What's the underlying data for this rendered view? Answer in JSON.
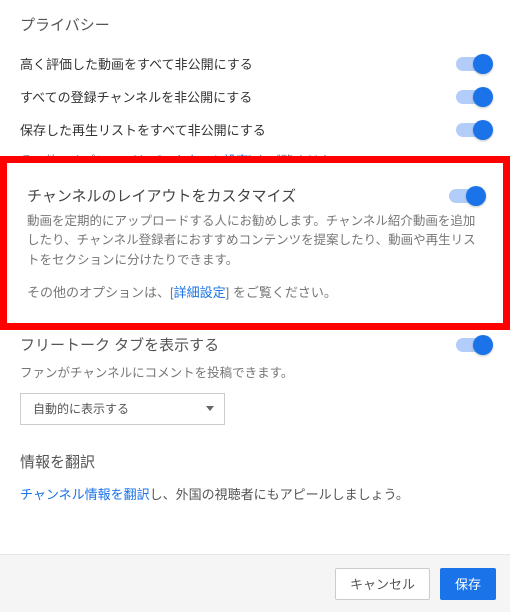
{
  "privacy": {
    "heading": "プライバシー",
    "rows": [
      {
        "label": "高く評価した動画をすべて非公開にする",
        "on": true
      },
      {
        "label": "すべての登録チャンネルを非公開にする",
        "on": true
      },
      {
        "label": "保存した再生リストをすべて非公開にする",
        "on": true
      }
    ],
    "more_prefix": "その他のオプションは、[",
    "more_link": "アカウント設定",
    "more_suffix": "] をご覧ください。"
  },
  "layout_box": {
    "heading": "チャンネルのレイアウトをカスタマイズ",
    "desc": "動画を定期的にアップロードする人にお勧めします。チャンネル紹介動画を追加したり、チャンネル登録者におすすめコンテンツを提案したり、動画や再生リストをセクションに分けたりできます。",
    "more_prefix": "その他のオプションは、[",
    "more_link": "詳細設定",
    "more_suffix": "] をご覧ください。",
    "on": true
  },
  "discussion": {
    "heading": "フリートーク タブを表示する",
    "desc": "ファンがチャンネルにコメントを投稿できます。",
    "on": true,
    "dropdown_value": "自動的に表示する"
  },
  "translate": {
    "heading": "情報を翻訳",
    "link": "チャンネル情報を翻訳",
    "rest": "し、外国の視聴者にもアピールしましょう。"
  },
  "footer": {
    "cancel": "キャンセル",
    "save": "保存"
  }
}
